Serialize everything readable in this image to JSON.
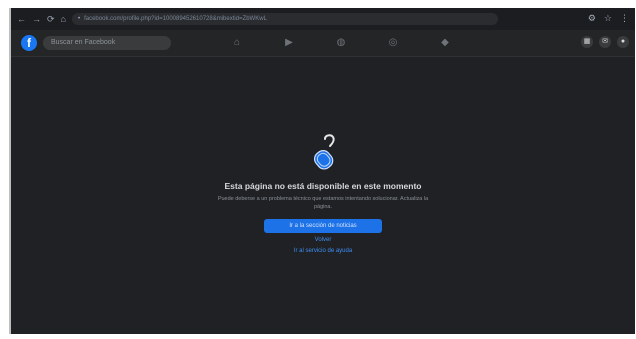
{
  "browser": {
    "nav": [
      "←",
      "→",
      "⟳",
      "⌂"
    ],
    "address": "facebook.com/profile.php?id=100089452610728&mibextid=ZbWKwL",
    "right_icons": [
      "⚙",
      "☆",
      "⋮"
    ]
  },
  "facebook": {
    "logo": "f",
    "search_placeholder": "Buscar en Facebook",
    "nav_icons": [
      "home-icon",
      "video-icon",
      "marketplace-icon",
      "groups-icon",
      "gaming-icon"
    ],
    "nav_glyphs": [
      "⌂",
      "▶",
      "◍",
      "◎",
      "◆"
    ],
    "actions": [
      "▦",
      "✉",
      "●"
    ]
  },
  "error": {
    "title": "Esta página no está disponible en este momento",
    "body": "Puede deberse a un problema técnico que estamos intentando solucionar. Actualiza la página.",
    "primary_button": "Ir a la sección de noticias",
    "link_back": "Volver",
    "link_help": "Ir al servicio de ayuda"
  },
  "colors": {
    "accent": "#1d72e8",
    "link": "#3d8ff5",
    "background": "#202124"
  }
}
